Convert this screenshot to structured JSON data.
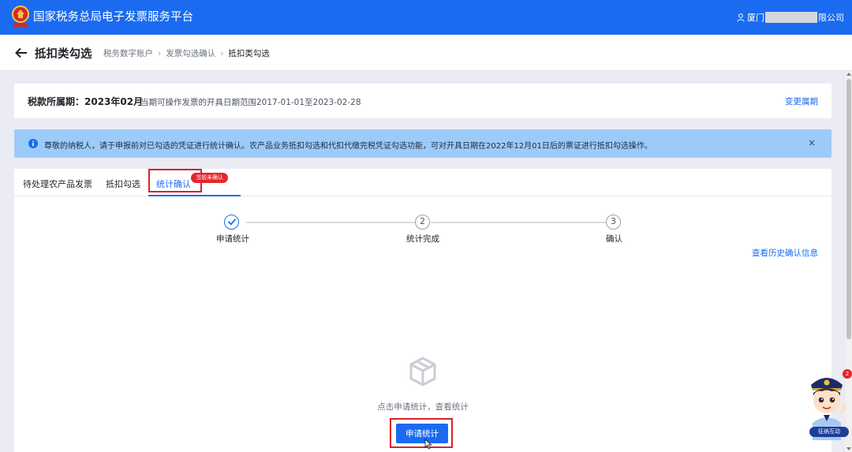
{
  "header": {
    "app_title": "国家税务总局电子发票服务平台",
    "user_prefix": "厦门",
    "user_suffix": "限公司",
    "logo": "national-tax-emblem",
    "brand_color": "#1a6bf0"
  },
  "breadcrumb": {
    "page_title": "抵扣类勾选",
    "items": [
      "税务数字账户",
      "发票勾选确认",
      "抵扣类勾选"
    ],
    "separator": "›"
  },
  "period": {
    "label": "税款所属期：2023年02月",
    "range_text": "当期可操作发票的开具日期范围2017-01-01至2023-02-28",
    "change_link": "变更属期"
  },
  "notice": {
    "icon": "info-icon",
    "text": "尊敬的纳税人，请于申报前对已勾选的凭证进行统计确认。农产品业务抵扣勾选和代扣代缴完税凭证勾选功能，可对开具日期在2022年12月01日后的票证进行抵扣勾选操作。",
    "close": "×",
    "bg_color": "#9ccbf9"
  },
  "tabs": {
    "items": [
      "待处理农产品发票",
      "抵扣勾选",
      "统计确认"
    ],
    "active_index": 2,
    "badge": "当前未确认"
  },
  "steps": {
    "items": [
      {
        "number": "✓",
        "label": "申请统计",
        "status": "done"
      },
      {
        "number": "2",
        "label": "统计完成",
        "status": "pending"
      },
      {
        "number": "3",
        "label": "确认",
        "status": "pending"
      }
    ]
  },
  "history_link": "查看历史确认信息",
  "empty_state": {
    "icon": "empty-box-icon",
    "text": "点击申请统计，查看统计"
  },
  "apply_button": "申请统计",
  "assistant": {
    "badge_count": "2",
    "label": "征纳互动",
    "icon": "tax-officer-avatar"
  },
  "highlight_color": "#d9222a"
}
